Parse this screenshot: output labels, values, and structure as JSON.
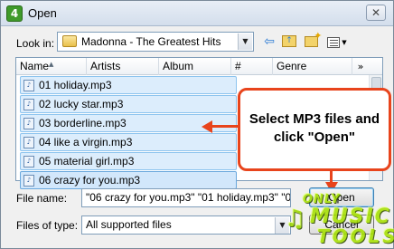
{
  "window": {
    "title": "Open",
    "app_icon_glyph": "4",
    "close_glyph": "✕"
  },
  "lookin": {
    "label": "Look in:",
    "value": "Madonna - The Greatest Hits",
    "icon": "folder-icon"
  },
  "toolbar": {
    "back_icon": "back-arrow-icon",
    "up_icon": "up-folder-icon",
    "new_icon": "new-folder-icon",
    "view_icon": "view-menu-icon"
  },
  "columns": [
    "Name",
    "Artists",
    "Album",
    "#",
    "Genre"
  ],
  "more_columns_glyph": "»",
  "files": [
    "01 holiday.mp3",
    "02 lucky star.mp3",
    "03 borderline.mp3",
    "04 like a virgin.mp3",
    "05 material girl.mp3",
    "06 crazy for you.mp3"
  ],
  "annotation": {
    "text": "Select MP3 files and click \"Open\"",
    "color": "#e8441c"
  },
  "filename": {
    "label": "File name:",
    "value": "\"06 crazy for you.mp3\" \"01 holiday.mp3\" \"02 lucky star.mp3\""
  },
  "filetype": {
    "label": "Files of type:",
    "value": "All supported files"
  },
  "buttons": {
    "open": "Open",
    "cancel": "Cancel"
  },
  "watermark": {
    "line1": "ONLY",
    "line2": "MUSIC",
    "line3": "TOOLS"
  },
  "colors": {
    "selection": "#dcedfc",
    "selection_border": "#8cc3ee",
    "accent": "#3c7fb1"
  }
}
